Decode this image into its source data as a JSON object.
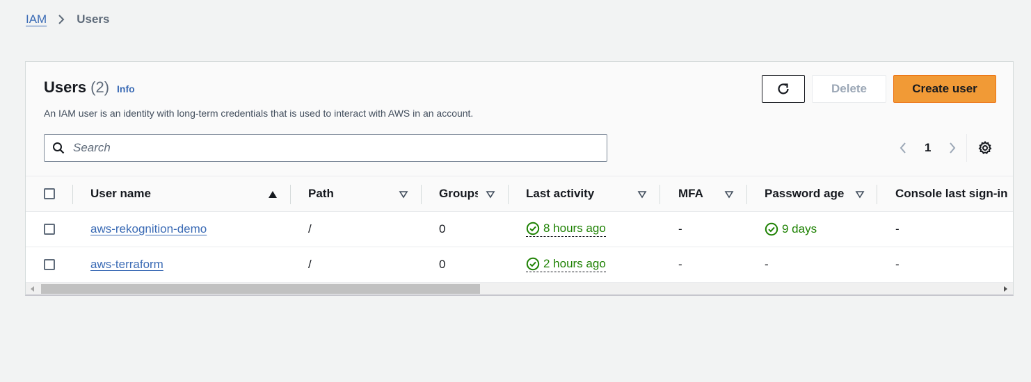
{
  "breadcrumb": {
    "parent": "IAM",
    "current": "Users"
  },
  "panel": {
    "title": "Users",
    "count": "(2)",
    "info": "Info",
    "description": "An IAM user is an identity with long-term credentials that is used to interact with AWS in an account."
  },
  "buttons": {
    "delete": "Delete",
    "create": "Create user"
  },
  "search": {
    "placeholder": "Search",
    "value": ""
  },
  "pagination": {
    "current_page": "1"
  },
  "table": {
    "columns": [
      "User name",
      "Path",
      "Groups",
      "Last activity",
      "MFA",
      "Password age",
      "Console last sign-in"
    ],
    "rows": [
      {
        "user_name": "aws-rekognition-demo",
        "path": "/",
        "groups": "0",
        "last_activity": "8 hours ago",
        "mfa": "-",
        "password_age": "9 days",
        "console_last_sign_in": "-"
      },
      {
        "user_name": "aws-terraform",
        "path": "/",
        "groups": "0",
        "last_activity": "2 hours ago",
        "mfa": "-",
        "password_age": "-",
        "console_last_sign_in": "-"
      }
    ]
  },
  "colors": {
    "primary_button": "#f19a36",
    "link": "#3b6bb5",
    "success": "#1d8102",
    "background": "#f2f3f3"
  },
  "icons": [
    "chevron-right-icon",
    "refresh-icon",
    "search-icon",
    "chevron-left-icon",
    "settings-icon",
    "sort-asc-icon",
    "sort-icon",
    "status-ok-icon"
  ]
}
